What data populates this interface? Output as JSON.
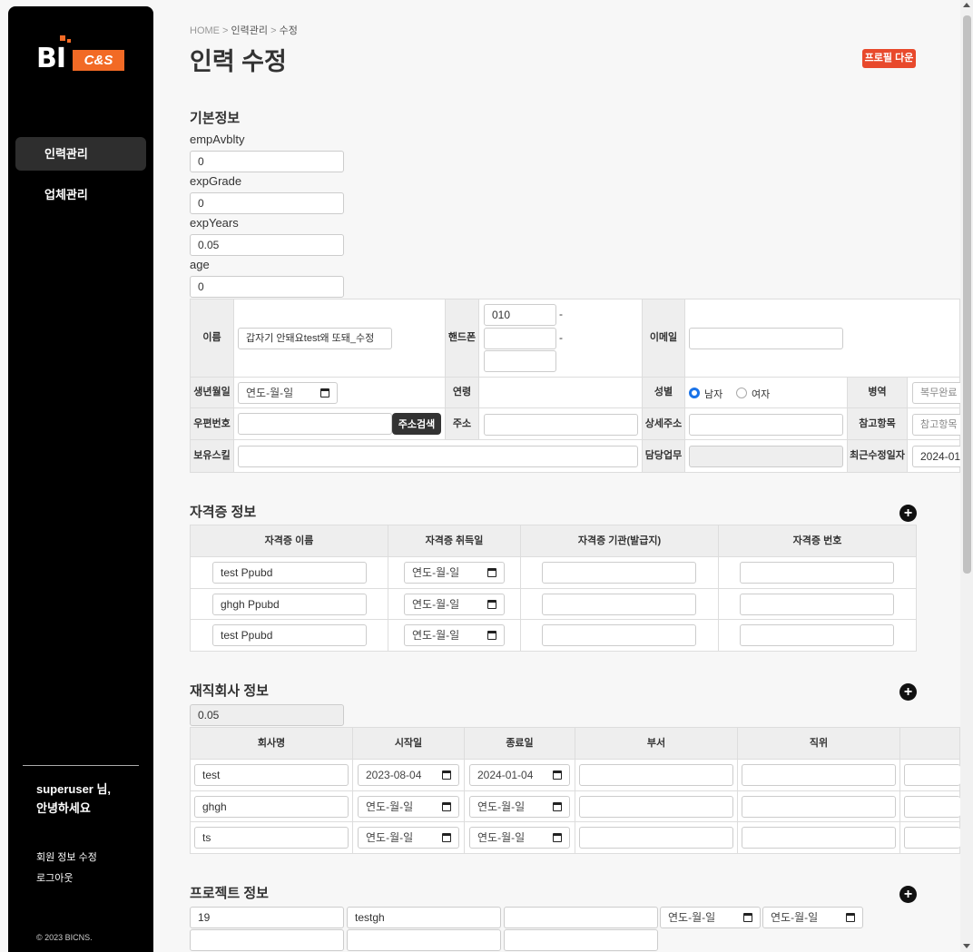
{
  "sidebar": {
    "logo_text": "BI",
    "logo_sub": "C&S",
    "nav": [
      {
        "label": "인력관리",
        "active": true
      },
      {
        "label": "업체관리",
        "active": false
      }
    ],
    "greeting_line1": "superuser 님,",
    "greeting_line2": "안녕하세요",
    "links": [
      "회원 정보 수정",
      "로그아웃"
    ],
    "copyright": "© 2023 BICNS."
  },
  "breadcrumb": {
    "home": "HOME",
    "sep1": " > ",
    "level1": "인력관리",
    "sep2": " > ",
    "current": "수정"
  },
  "page_title": "인력 수정",
  "profile_download_label": "프로필 다운",
  "basic_info": {
    "title": "기본정보",
    "fields": [
      {
        "label": "empAvblty",
        "value": "0"
      },
      {
        "label": "expGrade",
        "value": "0"
      },
      {
        "label": "expYears",
        "value": "0.05"
      },
      {
        "label": "age",
        "value": "0"
      }
    ],
    "name_label": "이름",
    "name_value": "갑자기 안돼요test왜 또돼_수정",
    "phone_label": "핸드폰",
    "phone_prefix": "010",
    "phone_dash": "-",
    "email_label": "이메일",
    "birth_label": "생년월일",
    "date_placeholder": "연도-월-일",
    "age_label": "연령",
    "gender_label": "성별",
    "gender_male": "남자",
    "gender_female": "여자",
    "military_label": "병역",
    "military_value": "복무완료",
    "zip_label": "우편번호",
    "zip_search_label": "주소검색",
    "address_label": "주소",
    "address_detail_label": "상세주소",
    "reference_label": "참고항목",
    "reference_placeholder": "참고항목",
    "skills_label": "보유스킬",
    "duty_label": "담당업무",
    "modified_label": "최근수정일자",
    "modified_value": "2024-01"
  },
  "certificates": {
    "title": "자격증 정보",
    "headers": [
      "자격증 이름",
      "자격증 취득일",
      "자격증 기관(발급지)",
      "자격증 번호"
    ],
    "rows": [
      {
        "name": "test Ppubd",
        "date": "연도-월-일"
      },
      {
        "name": "ghgh Ppubd",
        "date": "연도-월-일"
      },
      {
        "name": "test Ppubd",
        "date": "연도-월-일"
      }
    ]
  },
  "employment": {
    "title": "재직회사 정보",
    "years_value": "0.05",
    "headers": [
      "회사명",
      "시작일",
      "종료일",
      "부서",
      "직위"
    ],
    "rows": [
      {
        "company": "test",
        "start": "2023-08-04",
        "end": "2024-01-04"
      },
      {
        "company": "ghgh",
        "start": "연도-월-일",
        "end": "연도-월-일"
      },
      {
        "company": "ts",
        "start": "연도-월-일",
        "end": "연도-월-일"
      }
    ]
  },
  "projects": {
    "title": "프로젝트 정보",
    "row1": {
      "id": "19",
      "name": "testgh",
      "start": "연도-월-일",
      "end": "연도-월-일"
    }
  },
  "icons": {
    "plus": "add-circle-icon",
    "calendar": "calendar-icon"
  },
  "colors": {
    "accent": "#e8492c",
    "brand_orange": "#f26a25",
    "sidebar": "#000000",
    "radio_on": "#1a73e8"
  }
}
